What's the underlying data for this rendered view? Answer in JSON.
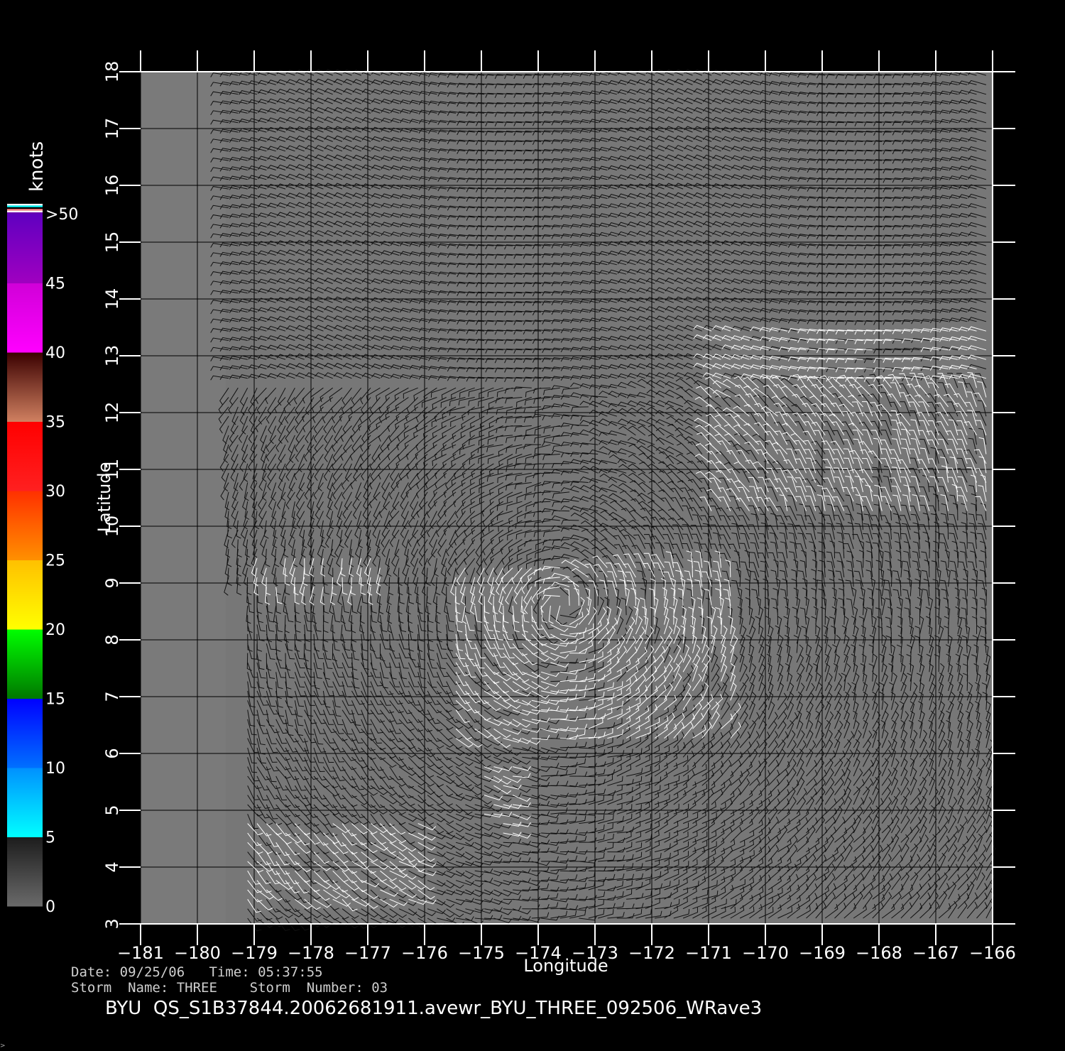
{
  "colors": {
    "background": "#000000",
    "land_fill": "#7a7a7a",
    "plot_fill": "#777777",
    "barb_low": "#111111",
    "barb_high": "#ffffff",
    "axis": "#ffffff"
  },
  "chart_data": {
    "type": "wind_barb_map",
    "xlabel": "Longitude",
    "ylabel": "Latitude",
    "xlim": [
      -181,
      -166
    ],
    "ylim": [
      3,
      18
    ],
    "x_ticks": [
      "−181",
      "−180",
      "−179",
      "−178",
      "−177",
      "−176",
      "−175",
      "−174",
      "−173",
      "−172",
      "−171",
      "−170",
      "−169",
      "−168",
      "−167",
      "−166"
    ],
    "y_ticks": [
      "3",
      "4",
      "5",
      "6",
      "7",
      "8",
      "9",
      "10",
      "11",
      "12",
      "13",
      "14",
      "15",
      "16",
      "17",
      "18"
    ],
    "grid": true,
    "data_coverage_min_lon": -179.5,
    "colorbar": {
      "unit": "knots",
      "labels": [
        "0",
        "5",
        "10",
        "15",
        "20",
        "25",
        "30",
        "35",
        "40",
        "45",
        ">50"
      ],
      "bands": [
        {
          "from": 0,
          "to": 5,
          "colors": [
            "#6a6a6a",
            "#1c1c1c"
          ]
        },
        {
          "from": 5,
          "to": 10,
          "colors": [
            "#00ffff",
            "#0090ff"
          ]
        },
        {
          "from": 10,
          "to": 15,
          "colors": [
            "#0070ff",
            "#0000ff"
          ]
        },
        {
          "from": 15,
          "to": 20,
          "colors": [
            "#007700",
            "#00ff00"
          ]
        },
        {
          "from": 20,
          "to": 25,
          "colors": [
            "#ffff00",
            "#ffc000"
          ]
        },
        {
          "from": 25,
          "to": 30,
          "colors": [
            "#ff9000",
            "#ff3000"
          ]
        },
        {
          "from": 30,
          "to": 35,
          "colors": [
            "#ff2020",
            "#ff0000"
          ]
        },
        {
          "from": 35,
          "to": 40,
          "colors": [
            "#d08060",
            "#3a0000"
          ]
        },
        {
          "from": 40,
          "to": 45,
          "colors": [
            "#ff00ff",
            "#d000d8"
          ]
        },
        {
          "from": 45,
          "to": 50,
          "colors": [
            "#a000c0",
            "#6000c0"
          ]
        }
      ]
    },
    "high_wind_regions": [
      {
        "lon": [
          -171,
          -166
        ],
        "lat": [
          10.2,
          13.5
        ]
      },
      {
        "lon": [
          -175.5,
          -170.5
        ],
        "lat": [
          6.2,
          9.3
        ]
      },
      {
        "lon": [
          -179,
          -176.7
        ],
        "lat": [
          8.9,
          9.6
        ]
      },
      {
        "lon": [
          -180,
          -176
        ],
        "lat": [
          3.3,
          4.8
        ]
      },
      {
        "lon": [
          -175,
          -174.3
        ],
        "lat": [
          4.6,
          5.8
        ]
      }
    ]
  },
  "info": {
    "date_line": "Date: 09/25/06   Time: 05:37:55",
    "storm_line": "Storm  Name: THREE    Storm  Number: 03",
    "title": "BYU  QS_S1B37844.20062681911.avewr_BYU_THREE_092506_WRave3",
    "corner_mark": ">"
  }
}
